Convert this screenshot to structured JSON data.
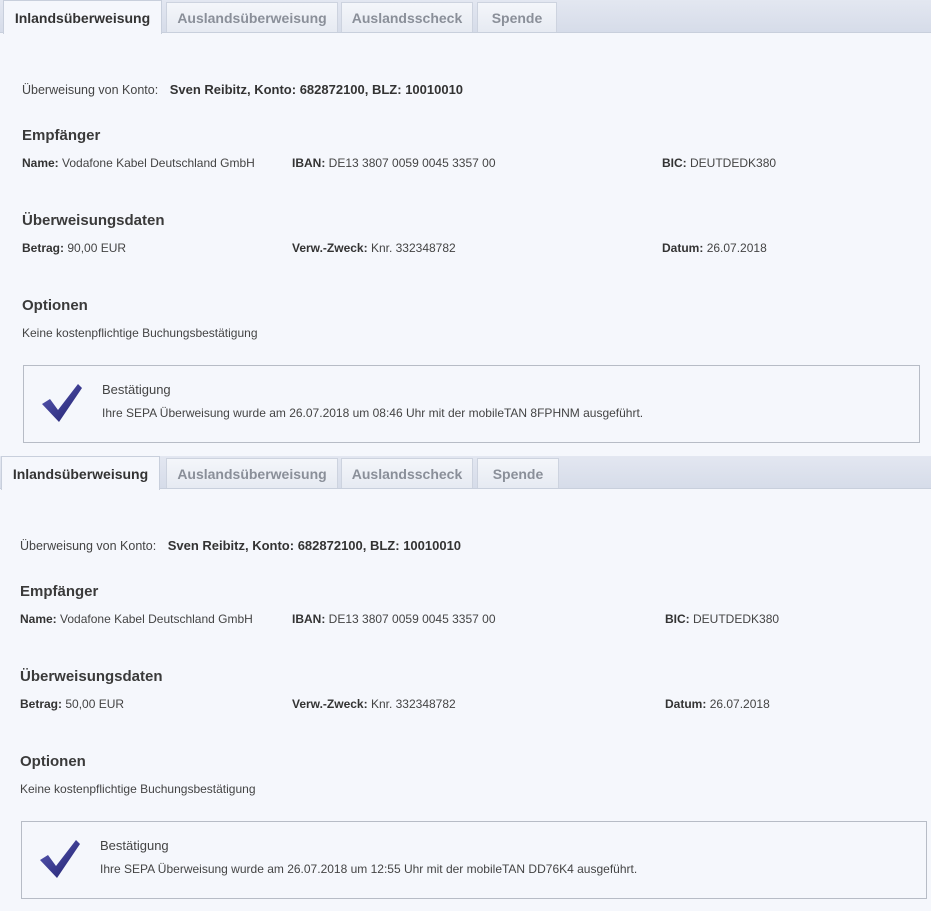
{
  "panels": [
    {
      "tabs": [
        "Inlandsüberweisung",
        "Auslandsüberweisung",
        "Auslandsscheck",
        "Spende"
      ],
      "account_label": "Überweisung von Konto:",
      "account_value": "Sven Reibitz, Konto: 682872100, BLZ: 10010010",
      "recipient_heading": "Empfänger",
      "name_label": "Name:",
      "name_value": "Vodafone Kabel Deutschland GmbH",
      "iban_label": "IBAN:",
      "iban_value": "DE13 3807 0059 0045 3357 00",
      "bic_label": "BIC:",
      "bic_value": "DEUTDEDK380",
      "transfer_heading": "Überweisungsdaten",
      "amount_label": "Betrag:",
      "amount_value": "90,00 EUR",
      "purpose_label": "Verw.-Zweck:",
      "purpose_value": "Knr. 332348782",
      "date_label": "Datum:",
      "date_value": "26.07.2018",
      "options_heading": "Optionen",
      "options_text": "Keine kostenpflichtige Buchungsbestätigung",
      "confirm_title": "Bestätigung",
      "confirm_text": "Ihre SEPA Überweisung wurde am 26.07.2018 um 08:46 Uhr mit der mobileTAN 8FPHNM ausgeführt.",
      "check_icon": "checkmark-icon"
    },
    {
      "tabs": [
        "Inlandsüberweisung",
        "Auslandsüberweisung",
        "Auslandsscheck",
        "Spende"
      ],
      "account_label": "Überweisung von Konto:",
      "account_value": "Sven Reibitz, Konto: 682872100, BLZ: 10010010",
      "recipient_heading": "Empfänger",
      "name_label": "Name:",
      "name_value": "Vodafone Kabel Deutschland GmbH",
      "iban_label": "IBAN:",
      "iban_value": "DE13 3807 0059 0045 3357 00",
      "bic_label": "BIC:",
      "bic_value": "DEUTDEDK380",
      "transfer_heading": "Überweisungsdaten",
      "amount_label": "Betrag:",
      "amount_value": "50,00 EUR",
      "purpose_label": "Verw.-Zweck:",
      "purpose_value": "Knr. 332348782",
      "date_label": "Datum:",
      "date_value": "26.07.2018",
      "options_heading": "Optionen",
      "options_text": "Keine kostenpflichtige Buchungsbestätigung",
      "confirm_title": "Bestätigung",
      "confirm_text": "Ihre SEPA Überweisung wurde am 26.07.2018 um 12:55 Uhr mit der mobileTAN DD76K4 ausgeführt.",
      "check_icon": "checkmark-icon"
    }
  ],
  "colors": {
    "check_dark": "#1f1f6e",
    "check_light": "#5b5bb5",
    "panel_bg": "#f5f7fc"
  }
}
